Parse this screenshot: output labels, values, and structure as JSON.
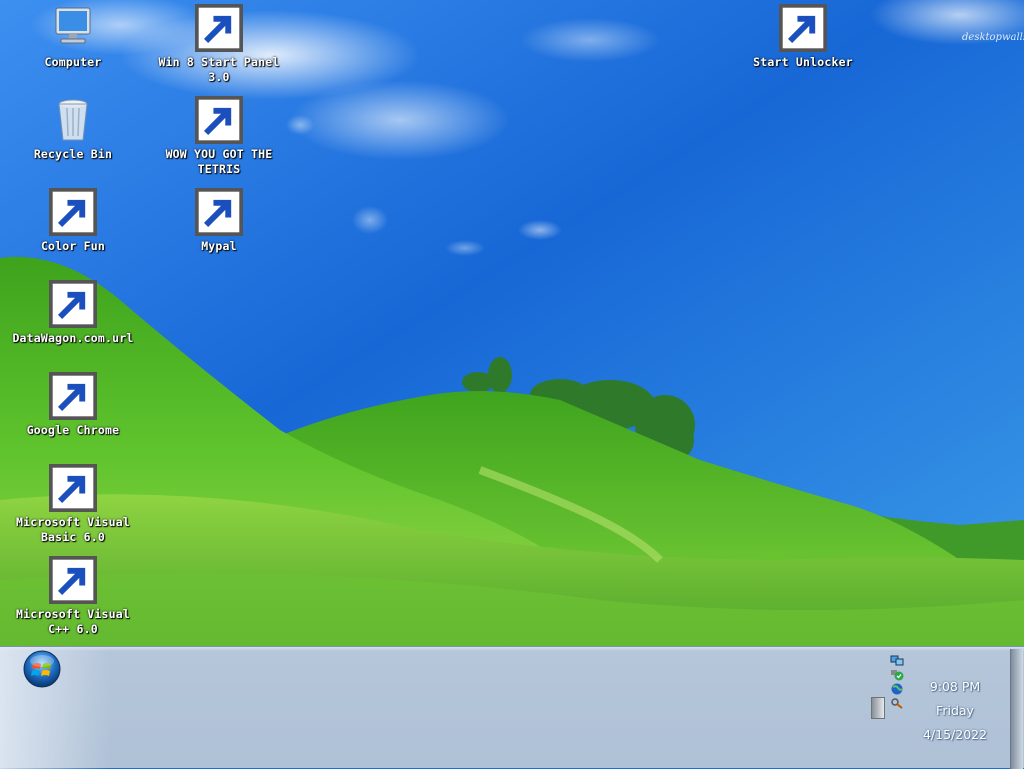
{
  "desktop": {
    "watermark": "desktopwalls",
    "icons": [
      {
        "label": "Computer",
        "icon": "computer-icon",
        "shortcut": false
      },
      {
        "label": "Recycle Bin",
        "icon": "recycle-bin-icon",
        "shortcut": false
      },
      {
        "label": "Color Fun",
        "icon": "color-fun-icon",
        "shortcut": true
      },
      {
        "label": "DataWagon.com.url",
        "icon": "datawagon-url-icon",
        "shortcut": true
      },
      {
        "label": "Google Chrome",
        "icon": "chrome-icon",
        "shortcut": true
      },
      {
        "label": "Microsoft Visual Basic 6.0",
        "icon": "visual-basic-icon",
        "shortcut": true
      },
      {
        "label": "Microsoft Visual C++ 6.0",
        "icon": "visual-cpp-icon",
        "shortcut": true
      },
      {
        "label": "Win 8 Start Panel 3.0",
        "icon": "windows-flag-icon",
        "shortcut": true
      },
      {
        "label": "WOW YOU GOT THE TETRIS",
        "icon": "tetris-icon",
        "shortcut": true
      },
      {
        "label": "Mypal",
        "icon": "raccoon-icon",
        "shortcut": true
      },
      {
        "label": "Start Unlocker",
        "icon": "magic-wand-icon",
        "shortcut": true
      }
    ]
  },
  "taskbar": {
    "start_button": "windows-orb-icon",
    "tray_icons": [
      "network-icon",
      "security-shield-icon",
      "globe-icon",
      "search-key-icon"
    ],
    "clock": {
      "time": "9:08 PM",
      "day": "Friday",
      "date": "4/15/2022"
    }
  },
  "colors": {
    "sky": "#1e70dd",
    "grass": "#46b52a",
    "taskbar": "#b1c3d8"
  }
}
